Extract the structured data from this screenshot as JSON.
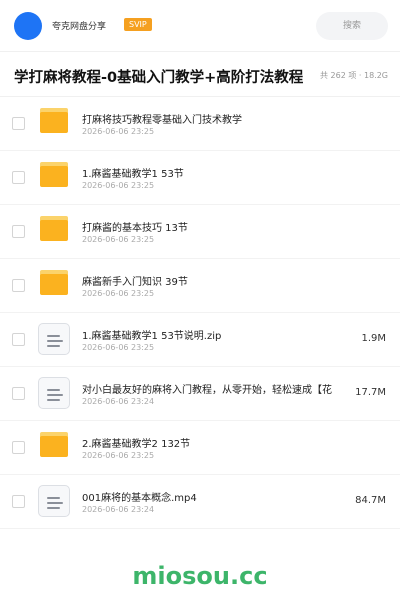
{
  "header": {
    "brand": "夸克网盘分享",
    "badge": "SVIP",
    "search_placeholder": "搜索"
  },
  "share": {
    "title": "学打麻将教程-0基础入门教学+高阶打法教程",
    "meta": "共 262 项 · 18.2G"
  },
  "files": [
    {
      "type": "folder",
      "name": "打麻将技巧教程零基础入门技术教学",
      "date": "2026-06-06 23:25",
      "size": ""
    },
    {
      "type": "folder",
      "name": "1.麻酱基础教学1  53节",
      "date": "2026-06-06 23:25",
      "size": ""
    },
    {
      "type": "folder",
      "name": "打麻酱的基本技巧 13节",
      "date": "2026-06-06 23:25",
      "size": ""
    },
    {
      "type": "folder",
      "name": "麻酱新手入门知识 39节",
      "date": "2026-06-06 23:25",
      "size": ""
    },
    {
      "type": "file",
      "name": "1.麻酱基础教学1  53节说明.zip",
      "date": "2026-06-06 23:25",
      "size": "1.9M"
    },
    {
      "type": "file",
      "name": "对小白最友好的麻将入门教程，从零开始，轻松速成【花",
      "date": "2026-06-06 23:24",
      "size": "17.7M"
    },
    {
      "type": "folder",
      "name": "2.麻酱基础教学2  132节",
      "date": "2026-06-06 23:25",
      "size": ""
    },
    {
      "type": "file",
      "name": "001麻将的基本概念.mp4",
      "date": "2026-06-06 23:24",
      "size": "84.7M"
    }
  ],
  "footer": {
    "watermark": "miosou.cc"
  },
  "colors": {
    "avatar": "#1e74f5",
    "badge": "#f5a020",
    "folder": "#fbb21f",
    "watermark": "#3db56a"
  }
}
